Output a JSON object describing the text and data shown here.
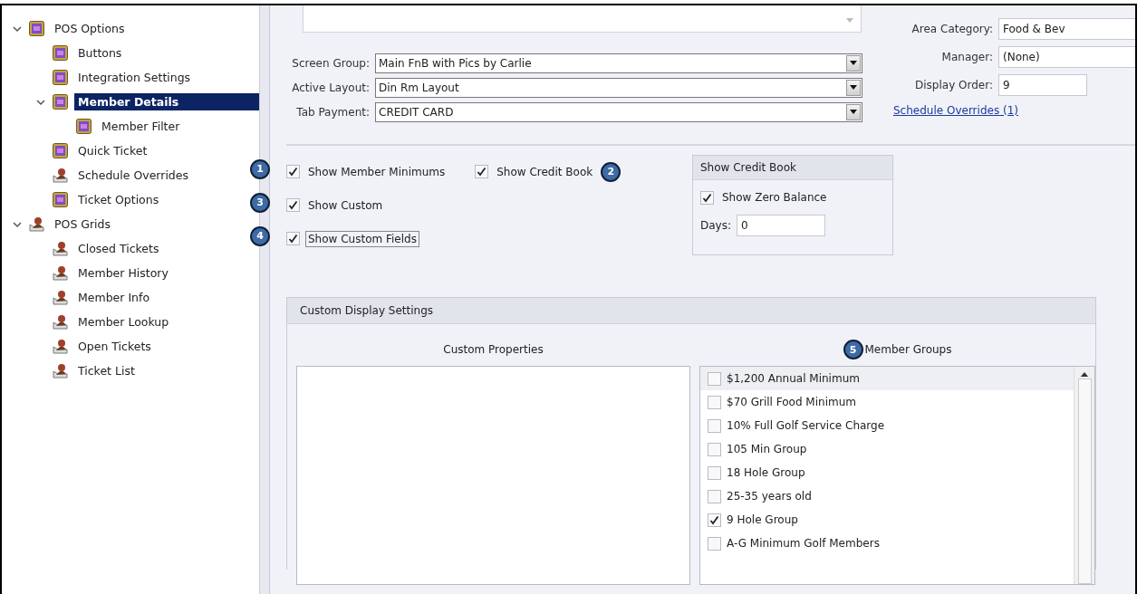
{
  "tree": [
    {
      "label": "POS Options",
      "kind": "form",
      "expanded": true,
      "selected": false,
      "children": [
        {
          "label": "Buttons",
          "kind": "form",
          "selected": false
        },
        {
          "label": "Integration Settings",
          "kind": "form",
          "selected": false
        },
        {
          "label": "Member Details",
          "kind": "form",
          "expanded": true,
          "selected": true,
          "children": [
            {
              "label": "Member Filter",
              "kind": "form",
              "selected": false
            }
          ]
        },
        {
          "label": "Quick Ticket",
          "kind": "form",
          "selected": false
        },
        {
          "label": "Schedule Overrides",
          "kind": "grid",
          "selected": false
        },
        {
          "label": "Ticket Options",
          "kind": "form",
          "selected": false
        }
      ]
    },
    {
      "label": "POS Grids",
      "kind": "grid",
      "expanded": true,
      "selected": false,
      "children": [
        {
          "label": "Closed Tickets",
          "kind": "grid",
          "selected": false
        },
        {
          "label": "Member History",
          "kind": "grid",
          "selected": false
        },
        {
          "label": "Member Info",
          "kind": "grid",
          "selected": false
        },
        {
          "label": "Member Lookup",
          "kind": "grid",
          "selected": false
        },
        {
          "label": "Open Tickets",
          "kind": "grid",
          "selected": false
        },
        {
          "label": "Ticket List",
          "kind": "grid",
          "selected": false
        }
      ]
    }
  ],
  "fields_left": [
    {
      "label": "Screen Group:",
      "value": "Main FnB with Pics by Carlie"
    },
    {
      "label": "Active Layout:",
      "value": "Din Rm Layout"
    },
    {
      "label": "Tab Payment:",
      "value": "CREDIT CARD"
    }
  ],
  "fields_right": [
    {
      "label": "Area Category:",
      "value": "Food & Bev",
      "kind": "wide"
    },
    {
      "label": "Manager:",
      "value": "(None)",
      "kind": "wide"
    },
    {
      "label": "Display Order:",
      "value": "9",
      "kind": "short"
    }
  ],
  "link": "Schedule Overrides (1)",
  "option_rows": [
    [
      {
        "label": "Show Member Minimums",
        "checked": true,
        "focused": false,
        "badge": "1"
      },
      {
        "label": "Show Credit Book",
        "checked": true,
        "focused": false,
        "badge": "2"
      }
    ],
    [
      {
        "label": "Show Custom",
        "checked": true,
        "focused": false,
        "badge": "3"
      }
    ],
    [
      {
        "label": "Show Custom Fields",
        "checked": true,
        "focused": true,
        "badge": "4"
      }
    ]
  ],
  "credit_book": {
    "title": "Show Credit Book",
    "zero_balance": {
      "label": "Show Zero Balance",
      "checked": true
    },
    "days": {
      "label": "Days:",
      "value": "0"
    }
  },
  "custom_display": {
    "title": "Custom Display Settings",
    "custom_properties": {
      "heading": "Custom Properties"
    },
    "member_groups": {
      "heading": "Member Groups",
      "badge": "5",
      "items": [
        {
          "label": "$1,200 Annual Minimum",
          "checked": false,
          "selected": true
        },
        {
          "label": "$70 Grill Food Minimum",
          "checked": false,
          "selected": false
        },
        {
          "label": "10% Full Golf Service Charge",
          "checked": false,
          "selected": false
        },
        {
          "label": "105 Min Group",
          "checked": false,
          "selected": false
        },
        {
          "label": "18 Hole Group",
          "checked": false,
          "selected": false
        },
        {
          "label": "25-35 years old",
          "checked": false,
          "selected": false
        },
        {
          "label": "9 Hole Group",
          "checked": true,
          "selected": false
        },
        {
          "label": "A-G Minimum Golf Members",
          "checked": false,
          "selected": false
        }
      ]
    }
  }
}
